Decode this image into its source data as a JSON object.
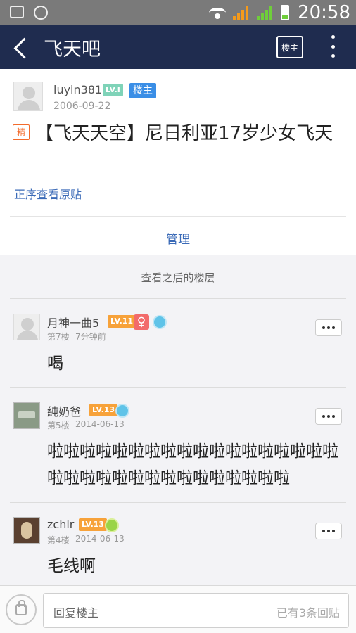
{
  "status_bar": {
    "time": "20:58"
  },
  "nav": {
    "title": "飞天吧",
    "louzhu_button": "楼主"
  },
  "main_post": {
    "author": "luyin381",
    "level": "LV.I",
    "role_badge": "楼主",
    "date": "2006-09-22",
    "essence_tag": "精",
    "title": "【飞天天空】尼日利亚17岁少女飞天",
    "original_link": "正序查看原贴",
    "manage": "管理"
  },
  "section_label": "查看之后的楼层",
  "replies": [
    {
      "name": "月神一曲5",
      "level": "LV.11",
      "gender": "♀",
      "floor": "第7楼",
      "time": "7分钟前",
      "content": "喝"
    },
    {
      "name": "純奶爸",
      "level": "LV.13",
      "floor": "第5楼",
      "time": "2014-06-13",
      "content": "啦啦啦啦啦啦啦啦啦啦啦啦啦啦啦啦啦啦啦啦啦啦啦啦啦啦啦啦啦啦啦啦啦"
    },
    {
      "name": "zchlr",
      "level": "LV.13",
      "floor": "第4楼",
      "time": "2014-06-13",
      "content": "毛线啊"
    }
  ],
  "reply_bar": {
    "placeholder": "回复楼主",
    "count": "已有3条回贴"
  },
  "colors": {
    "nav_bg": "#1f2c4f",
    "link": "#3a6ab7",
    "level_orange": "#f7a23a",
    "level_green": "#7fd3b8",
    "louzhu_blue": "#3a8ee6"
  }
}
